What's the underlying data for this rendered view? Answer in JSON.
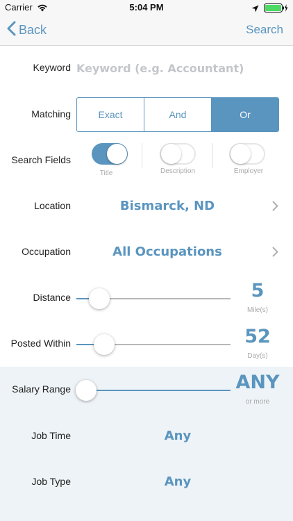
{
  "status_bar": {
    "carrier": "Carrier",
    "time": "5:04 PM"
  },
  "nav": {
    "back_label": "Back",
    "search_label": "Search"
  },
  "keyword": {
    "label": "Keyword",
    "placeholder": "Keyword (e.g. Accountant)",
    "value": ""
  },
  "matching": {
    "label": "Matching",
    "options": [
      "Exact",
      "And",
      "Or"
    ],
    "selected": "Or"
  },
  "search_fields": {
    "label": "Search Fields",
    "toggles": [
      {
        "caption": "Title",
        "on": true
      },
      {
        "caption": "Description",
        "on": false
      },
      {
        "caption": "Employer",
        "on": false
      }
    ]
  },
  "location": {
    "label": "Location",
    "value": "Bismarck, ND"
  },
  "occupation": {
    "label": "Occupation",
    "value": "All Occupations"
  },
  "distance": {
    "label": "Distance",
    "value": "5",
    "unit": "Mile(s)",
    "fraction": 0.15
  },
  "posted_within": {
    "label": "Posted Within",
    "value": "52",
    "unit": "Day(s)",
    "fraction": 0.18
  },
  "salary_range": {
    "label": "Salary Range",
    "value": "ANY",
    "unit": "or more",
    "fraction": 0.0
  },
  "job_time": {
    "label": "Job Time",
    "value": "Any"
  },
  "job_type": {
    "label": "Job Type",
    "value": "Any"
  },
  "colors": {
    "accent": "#5a95bf",
    "shaded_background": "#eef3f7",
    "placeholder": "#c3c6ca"
  }
}
